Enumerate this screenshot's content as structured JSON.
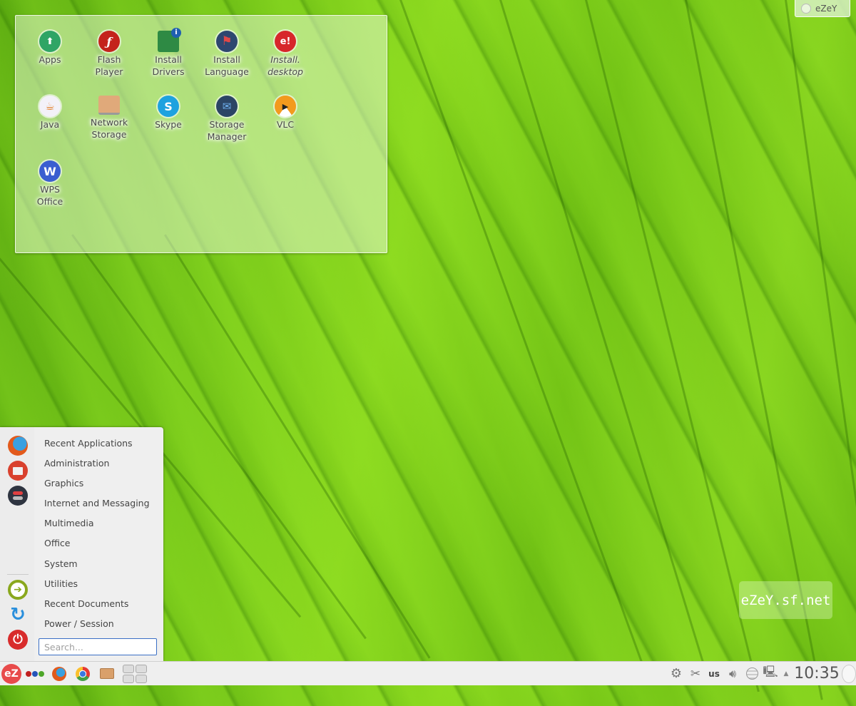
{
  "desktop": {
    "folder_icons": [
      {
        "name": "Apps",
        "line1": "Apps",
        "line2": "",
        "icon": "apps-store-icon",
        "color": "#2fa565",
        "glyph": "⬆",
        "italic": false
      },
      {
        "name": "Flash Player",
        "line1": "Flash",
        "line2": "Player",
        "icon": "flash-player-icon",
        "color": "#c4231c",
        "glyph": "ƒ",
        "italic": false
      },
      {
        "name": "Install Drivers",
        "line1": "Install",
        "line2": "Drivers",
        "icon": "install-drivers-icon",
        "color": "#2e8a44",
        "glyph": "i",
        "italic": false
      },
      {
        "name": "Install Language",
        "line1": "Install",
        "line2": "Language",
        "icon": "install-language-flag-icon",
        "color": "#2e4770",
        "glyph": "⚑",
        "italic": false
      },
      {
        "name": "Install. desktop",
        "line1": "Install.",
        "line2": "desktop",
        "icon": "install-desktop-ezey-icon",
        "color": "#d7262b",
        "glyph": "e!",
        "italic": true
      },
      {
        "name": "Java",
        "line1": "Java",
        "line2": "",
        "icon": "java-icon",
        "color": "#f3f1f8",
        "glyph": "☕",
        "italic": false
      },
      {
        "name": "Network Storage",
        "line1": "Network",
        "line2": "Storage",
        "icon": "network-storage-folder-icon",
        "color": "#e0a97a",
        "glyph": "",
        "italic": false
      },
      {
        "name": "Skype",
        "line1": "Skype",
        "line2": "",
        "icon": "skype-icon",
        "color": "#1ea2df",
        "glyph": "S",
        "italic": false
      },
      {
        "name": "Storage Manager",
        "line1": "Storage",
        "line2": "Manager",
        "icon": "storage-manager-icon",
        "color": "#2c4565",
        "glyph": "✉",
        "italic": false
      },
      {
        "name": "VLC",
        "line1": "VLC",
        "line2": "",
        "icon": "vlc-icon",
        "color": "#f39a1e",
        "glyph": "▶",
        "italic": false
      },
      {
        "name": "WPS Office",
        "line1": "WPS",
        "line2": "Office",
        "icon": "wps-office-icon",
        "color": "#3a5ed0",
        "glyph": "W",
        "italic": false
      }
    ],
    "top_right_tab": {
      "label": "eZeY"
    },
    "watermark": "eZeY.sf.net"
  },
  "start_menu": {
    "favorites": [
      {
        "name": "firefox",
        "icon": "firefox-icon"
      },
      {
        "name": "files",
        "icon": "file-manager-icon"
      },
      {
        "name": "settings",
        "icon": "system-settings-toggle-icon"
      }
    ],
    "session_buttons": [
      {
        "name": "logout",
        "icon": "logout-icon"
      },
      {
        "name": "restart",
        "icon": "restart-icon"
      },
      {
        "name": "shutdown",
        "icon": "power-icon"
      }
    ],
    "categories": [
      "Recent Applications",
      "Administration",
      "Graphics",
      "Internet and Messaging",
      "Multimedia",
      "Office",
      "System",
      "Utilities",
      "Recent Documents",
      "Power / Session"
    ],
    "search": {
      "placeholder": "Search...",
      "value": ""
    }
  },
  "taskbar": {
    "launcher_label": "eZ",
    "tasks": [
      {
        "name": "activity-dots",
        "icon": "activities-icon"
      },
      {
        "name": "firefox",
        "icon": "firefox-icon"
      },
      {
        "name": "chrome",
        "icon": "chrome-icon"
      },
      {
        "name": "files",
        "icon": "file-manager-icon"
      },
      {
        "name": "pager",
        "icon": "virtual-desktop-pager"
      }
    ],
    "tray": {
      "keyboard_layout": "us",
      "clock": "10:35"
    },
    "colors": {
      "accent_red": "#e84b4b",
      "accent_blue": "#3a6fc5"
    }
  }
}
